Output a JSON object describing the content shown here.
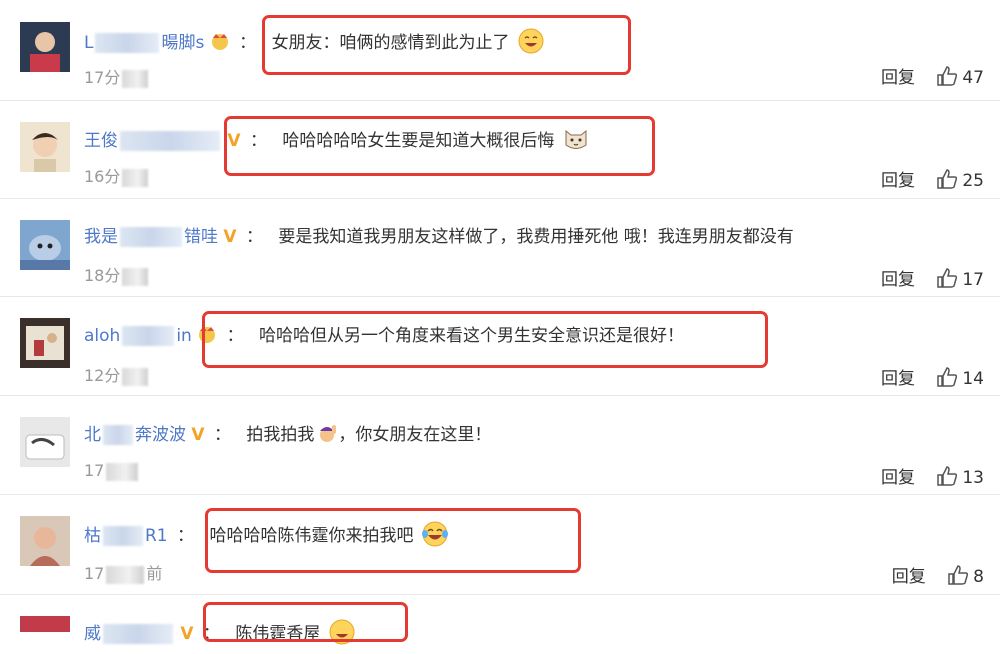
{
  "comments": [
    {
      "user_prefix": "L",
      "user_suffix": "暘脚s",
      "time": "17分",
      "text": "女朋友：咱俩的感情到此为止了",
      "likes": "47",
      "reply": "回复"
    },
    {
      "user_prefix": "王俊",
      "user_suffix": "",
      "time": "16分",
      "text": "哈哈哈哈哈女生要是知道大概很后悔",
      "likes": "25",
      "reply": "回复"
    },
    {
      "user_prefix": "我是",
      "user_suffix": "错哇",
      "time": "18分",
      "text": "要是我知道我男朋友这样做了，我费用捶死他 哦！我连男朋友都没有",
      "likes": "17",
      "reply": "回复"
    },
    {
      "user_prefix": "aloh",
      "user_suffix": "in",
      "time": "12分",
      "text": "哈哈哈但从另一个角度来看这个男生安全意识还是很好！",
      "likes": "14",
      "reply": "回复"
    },
    {
      "user_prefix": "北",
      "user_suffix": "奔波波",
      "time": "17",
      "text_a": "拍我拍我",
      "text_b": "，你女朋友在这里！",
      "likes": "13",
      "reply": "回复"
    },
    {
      "user_prefix": "枯",
      "user_suffix": "R1",
      "time": "17",
      "time_suffix": "前",
      "text": "哈哈哈哈陈伟霆你来拍我吧",
      "likes": "8",
      "reply": "回复"
    },
    {
      "user_prefix": "威",
      "user_suffix": "",
      "time": "",
      "text": "陈伟霆香屋",
      "likes": "",
      "reply": ""
    }
  ],
  "colors": {
    "username": "#4e79c8",
    "highlight": "#e53a32",
    "vip": "#f3a327",
    "time": "#999999"
  }
}
